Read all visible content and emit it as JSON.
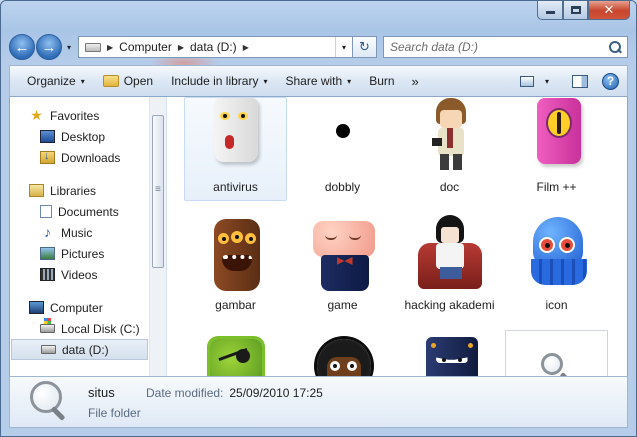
{
  "window": {
    "close_glyph": "✕"
  },
  "nav": {
    "back_glyph": "←",
    "forward_glyph": "→",
    "history_glyph": "▾",
    "breadcrumb": [
      "Computer",
      "data (D:)"
    ],
    "crumb_sep": "▶",
    "address_drop_glyph": "▾",
    "refresh_glyph": "↻",
    "search_placeholder": "Search data (D:)"
  },
  "toolbar": {
    "organize": "Organize",
    "open": "Open",
    "include_in_library": "Include in library",
    "share_with": "Share with",
    "burn": "Burn",
    "more_glyph": "»",
    "dropdown_glyph": "▾",
    "help_glyph": "?"
  },
  "sidebar": {
    "favorites": {
      "label": "Favorites",
      "items": [
        "Desktop",
        "Downloads"
      ]
    },
    "libraries": {
      "label": "Libraries",
      "items": [
        "Documents",
        "Music",
        "Pictures",
        "Videos"
      ]
    },
    "computer": {
      "label": "Computer",
      "items": [
        "Local Disk (C:)",
        "data (D:)"
      ]
    }
  },
  "files": [
    {
      "name": "antivirus",
      "icon": "white-ghost-monster-icon"
    },
    {
      "name": "dobbly",
      "icon": "black-dot-icon"
    },
    {
      "name": "doc",
      "icon": "anime-boy-figure-icon"
    },
    {
      "name": "Film ++",
      "icon": "pink-cyclops-monster-icon"
    },
    {
      "name": "gambar",
      "icon": "brown-multi-eye-monster-icon"
    },
    {
      "name": "game",
      "icon": "smiling-pink-creature-icon"
    },
    {
      "name": "hacking akademi",
      "icon": "anime-boy-in-chair-icon"
    },
    {
      "name": "icon",
      "icon": "blue-octopus-monster-icon"
    },
    {
      "name": "",
      "icon": "green-pirate-monster-icon"
    },
    {
      "name": "",
      "icon": "afro-black-creature-icon"
    },
    {
      "name": "",
      "icon": "dark-blue-dice-monster-icon"
    },
    {
      "name": "",
      "icon": "magnifier-folder-icon"
    }
  ],
  "details": {
    "name": "situs",
    "date_modified_label": "Date modified:",
    "date_modified_value": "25/09/2010 17:25",
    "type": "File folder"
  }
}
